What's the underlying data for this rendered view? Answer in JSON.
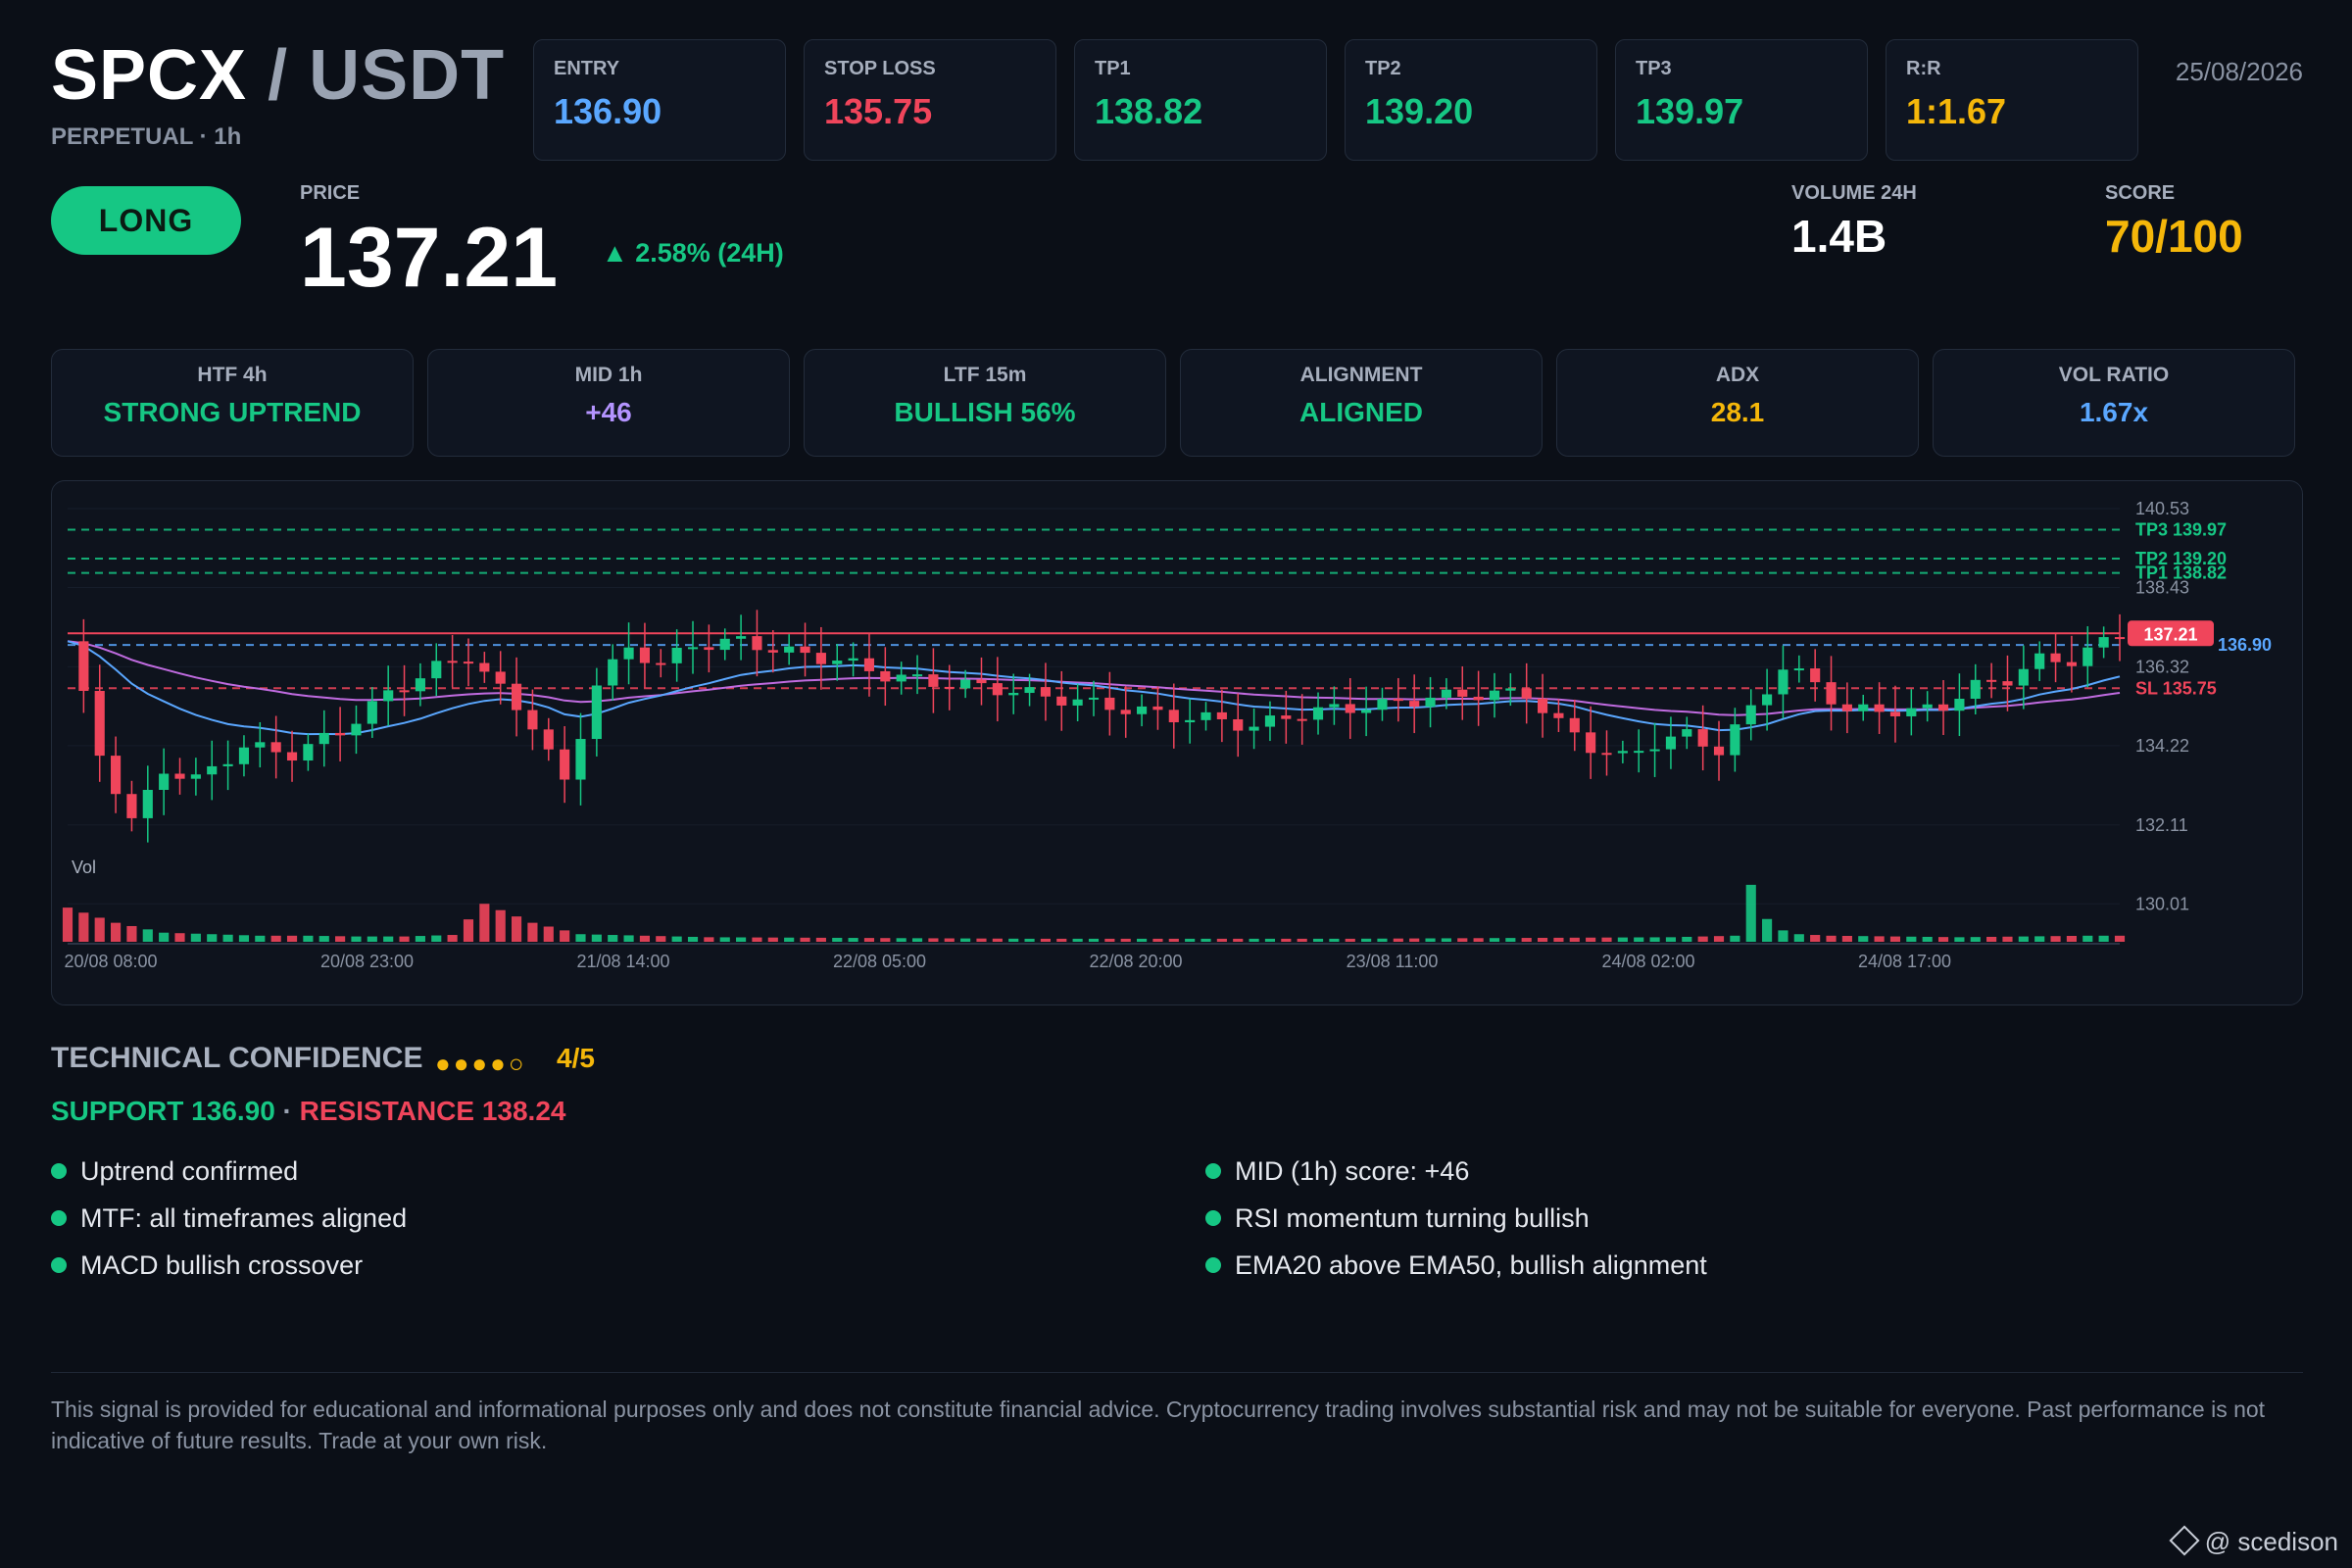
{
  "header": {
    "base": "SPCX",
    "separator": " / ",
    "quote": "USDT",
    "subtitle": "PERPETUAL · 1h",
    "date": "25/08/2026"
  },
  "levels": [
    {
      "label": "ENTRY",
      "value": "136.90",
      "color": "#5aa7ff"
    },
    {
      "label": "STOP LOSS",
      "value": "135.75",
      "color": "#f0455b"
    },
    {
      "label": "TP1",
      "value": "138.82",
      "color": "#16c784"
    },
    {
      "label": "TP2",
      "value": "139.20",
      "color": "#16c784"
    },
    {
      "label": "TP3",
      "value": "139.97",
      "color": "#16c784"
    },
    {
      "label": "R:R",
      "value": "1:1.67",
      "color": "#f5b70a"
    }
  ],
  "signal": {
    "direction": "LONG",
    "price_label": "PRICE",
    "price": "137.21",
    "change": "▲ 2.58% (24H)",
    "volume_label": "VOLUME 24H",
    "volume": "1.4B",
    "score_label": "SCORE",
    "score": "70/100"
  },
  "cards": [
    {
      "label": "HTF 4h",
      "value": "STRONG UPTREND",
      "color": "#16c784"
    },
    {
      "label": "MID 1h",
      "value": "+46",
      "color": "#b494ff"
    },
    {
      "label": "LTF 15m",
      "value": "BULLISH 56%",
      "color": "#16c784"
    },
    {
      "label": "ALIGNMENT",
      "value": "ALIGNED",
      "color": "#16c784"
    },
    {
      "label": "ADX",
      "value": "28.1",
      "color": "#f5b70a"
    },
    {
      "label": "VOL RATIO",
      "value": "1.67x",
      "color": "#5aa7ff"
    }
  ],
  "chart_data": {
    "type": "candlestick",
    "y_ticks": [
      140.53,
      138.43,
      136.32,
      134.22,
      132.11,
      130.01
    ],
    "ylim": [
      129.0,
      141.0
    ],
    "x_ticks": [
      "20/08 08:00",
      "20/08 23:00",
      "21/08 14:00",
      "22/08 05:00",
      "22/08 20:00",
      "23/08 11:00",
      "24/08 02:00",
      "24/08 17:00"
    ],
    "volume_label": "Vol",
    "levels": [
      {
        "label": "TP3 139.97",
        "value": 139.97,
        "color": "#16c784"
      },
      {
        "label": "TP2 139.20",
        "value": 139.2,
        "color": "#16c784"
      },
      {
        "label": "TP1 138.82",
        "value": 138.82,
        "color": "#16c784"
      },
      {
        "label": "SL 135.75",
        "value": 135.75,
        "color": "#f0455b"
      },
      {
        "label": "136.90",
        "value": 136.9,
        "color": "#5aa7ff"
      }
    ],
    "current_price": {
      "label": "137.21",
      "value": 137.21,
      "color": "#f0455b"
    },
    "close_points": [
      [
        0,
        137.0
      ],
      [
        2,
        134.0
      ],
      [
        4,
        132.2
      ],
      [
        6,
        133.6
      ],
      [
        8,
        133.3
      ],
      [
        11,
        134.2
      ],
      [
        14,
        134.0
      ],
      [
        17,
        134.6
      ],
      [
        20,
        135.6
      ],
      [
        23,
        136.3
      ],
      [
        25,
        136.6
      ],
      [
        27,
        135.7
      ],
      [
        29,
        134.8
      ],
      [
        31,
        133.2
      ],
      [
        33,
        135.9
      ],
      [
        35,
        136.8
      ],
      [
        37,
        136.4
      ],
      [
        39,
        136.9
      ],
      [
        42,
        137.0
      ],
      [
        45,
        136.7
      ],
      [
        48,
        136.5
      ],
      [
        51,
        136.1
      ],
      [
        54,
        135.9
      ],
      [
        57,
        135.8
      ],
      [
        60,
        135.6
      ],
      [
        63,
        135.4
      ],
      [
        66,
        135.2
      ],
      [
        69,
        135.0
      ],
      [
        72,
        134.9
      ],
      [
        74,
        134.7
      ],
      [
        76,
        135.0
      ],
      [
        79,
        135.2
      ],
      [
        82,
        135.3
      ],
      [
        85,
        135.5
      ],
      [
        88,
        135.6
      ],
      [
        91,
        135.6
      ],
      [
        93,
        134.8
      ],
      [
        95,
        134.2
      ],
      [
        97,
        133.9
      ],
      [
        99,
        134.3
      ],
      [
        101,
        134.5
      ],
      [
        103,
        134.1
      ],
      [
        105,
        135.2
      ],
      [
        107,
        136.3
      ],
      [
        109,
        135.9
      ],
      [
        111,
        135.1
      ],
      [
        113,
        135.2
      ],
      [
        115,
        135.1
      ],
      [
        117,
        135.3
      ],
      [
        119,
        135.8
      ],
      [
        121,
        136.0
      ],
      [
        123,
        136.5
      ],
      [
        125,
        136.5
      ],
      [
        128,
        137.21
      ]
    ],
    "volume_x": [
      0,
      3,
      6,
      9,
      12,
      15,
      18,
      21,
      24,
      26,
      29,
      32,
      40,
      50,
      60,
      70,
      80,
      90,
      100,
      104,
      105,
      106,
      107,
      108,
      110,
      114,
      118,
      122,
      126,
      128
    ],
    "volume_values": [
      4.5,
      2.5,
      1.2,
      1.0,
      0.8,
      0.8,
      0.7,
      0.7,
      0.9,
      5.0,
      2.5,
      1.0,
      0.6,
      0.5,
      0.4,
      0.4,
      0.4,
      0.5,
      0.6,
      0.8,
      7.5,
      3.0,
      1.5,
      1.0,
      0.8,
      0.7,
      0.6,
      0.7,
      0.8,
      0.8
    ],
    "volume_max": 8
  },
  "confidence": {
    "title": "TECHNICAL CONFIDENCE",
    "dots": "●●●●○",
    "score": "4/5",
    "support": "SUPPORT 136.90",
    "dot_sep": " · ",
    "resistance": "RESISTANCE 138.24"
  },
  "reasons_left": [
    "Uptrend confirmed",
    "MTF: all timeframes aligned",
    "MACD bullish crossover"
  ],
  "reasons_right": [
    "MID (1h) score: +46",
    "RSI momentum turning bullish",
    "EMA20 above EMA50, bullish alignment"
  ],
  "disclaimer": "This signal is provided for educational and informational purposes only and does not constitute financial advice. Cryptocurrency trading involves substantial risk and may not be suitable for everyone. Past performance is not indicative of future results. Trade at your own risk.",
  "watermark": "@ scedison"
}
